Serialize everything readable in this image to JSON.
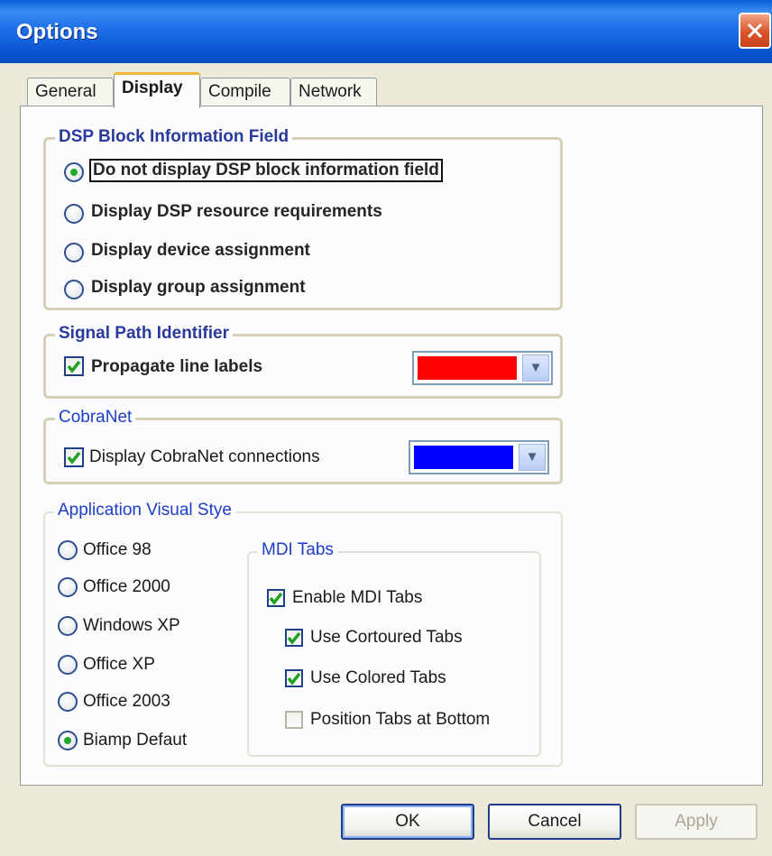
{
  "window": {
    "title": "Options"
  },
  "tabs": [
    {
      "label": "General"
    },
    {
      "label": "Display"
    },
    {
      "label": "Compile"
    },
    {
      "label": "Network"
    }
  ],
  "dsp_group": {
    "title": "DSP Block Information Field",
    "options": [
      {
        "label": "Do not display DSP block information field",
        "selected": true
      },
      {
        "label": "Display DSP resource requirements",
        "selected": false
      },
      {
        "label": "Display device assignment",
        "selected": false
      },
      {
        "label": "Display group assignment",
        "selected": false
      }
    ]
  },
  "signal_group": {
    "title": "Signal Path Identifier",
    "checkbox_label": "Propagate line labels",
    "checked": true,
    "color": "#ff0000"
  },
  "cobranet_group": {
    "title": "CobraNet",
    "checkbox_label": "Display CobraNet connections",
    "checked": true,
    "color": "#0000ff"
  },
  "visual_style_group": {
    "title": "Application Visual Stye",
    "options": [
      {
        "label": "Office 98",
        "selected": false
      },
      {
        "label": "Office 2000",
        "selected": false
      },
      {
        "label": "Windows XP",
        "selected": false
      },
      {
        "label": "Office XP",
        "selected": false
      },
      {
        "label": "Office 2003",
        "selected": false
      },
      {
        "label": "Biamp Defaut",
        "selected": true
      }
    ]
  },
  "mdi_group": {
    "title": "MDI Tabs",
    "items": [
      {
        "label": "Enable MDI Tabs",
        "checked": true
      },
      {
        "label": "Use Cortoured Tabs",
        "checked": true
      },
      {
        "label": "Use Colored Tabs",
        "checked": true
      },
      {
        "label": "Position Tabs at Bottom",
        "checked": false
      }
    ]
  },
  "buttons": {
    "ok": "OK",
    "cancel": "Cancel",
    "apply": "Apply"
  },
  "icons": {
    "close": "close-icon",
    "dropdown": "chevron-down-icon",
    "check": "checkmark-icon"
  }
}
